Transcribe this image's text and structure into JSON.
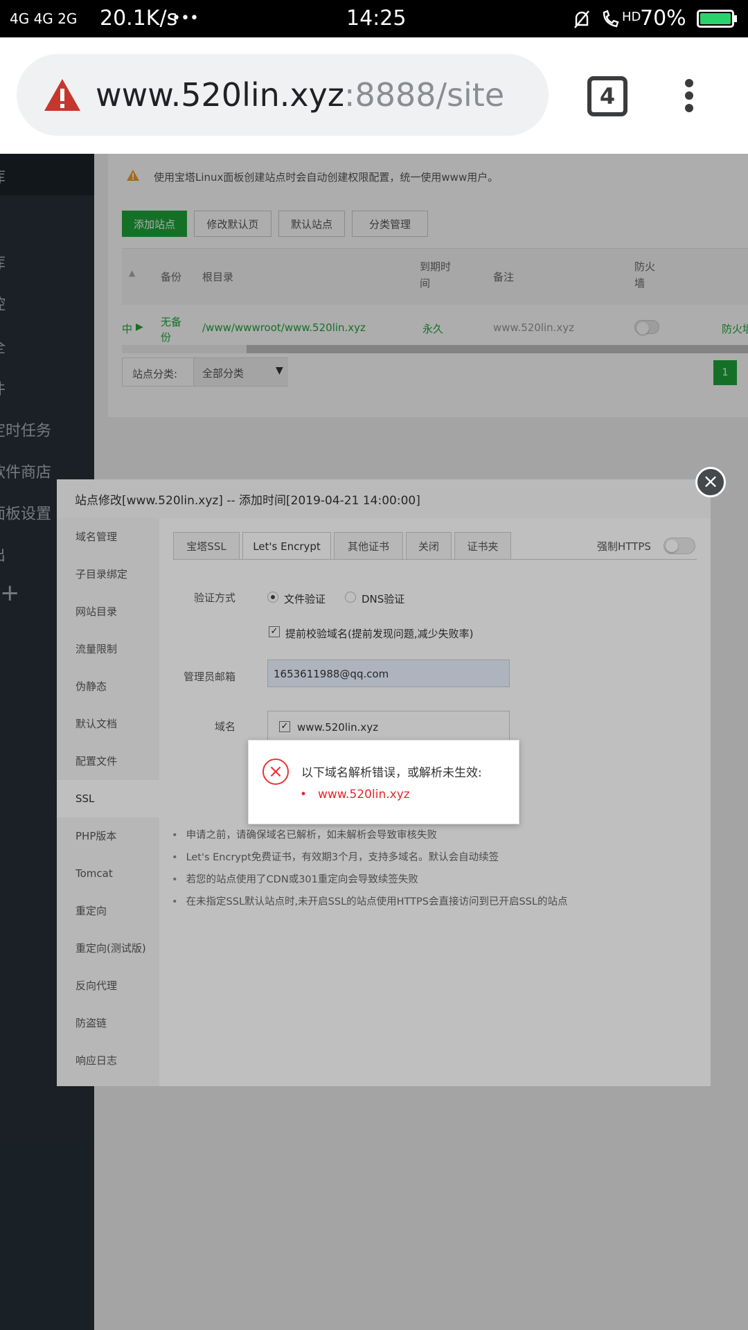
{
  "status_bar": {
    "network": "4G 4G 2G",
    "speed": "20.1K/s",
    "dots": "•••",
    "time": "14:25",
    "hd": "HD",
    "battery": "70%"
  },
  "browser": {
    "url_host": "www.520lin.xyz",
    "url_path": ":8888/site",
    "tab_count": "4",
    "security_icon": "warning-triangle-icon",
    "menu_icon": "vertical-dots-icon"
  },
  "sidebar": {
    "items": [
      "库",
      "库",
      "控",
      "全",
      "件",
      "定时任务",
      "软件商店",
      "面板设置",
      "出"
    ]
  },
  "site_page": {
    "notice": "使用宝塔Linux面板创建站点时会自动创建权限配置，统一使用www用户。",
    "buttons": [
      "添加站点",
      "修改默认页",
      "默认站点",
      "分类管理"
    ],
    "columns": [
      "备份",
      "根目录",
      "到期时间",
      "备注",
      "防火墙"
    ],
    "row": {
      "status": "中",
      "backup": "无备份",
      "root": "/www/wwwroot/www.520lin.xyz",
      "expire": "永久",
      "remark": "www.520lin.xyz",
      "action": "防火墙 |"
    },
    "category_label": "站点分类:",
    "category_value": "全部分类",
    "page_number": "1"
  },
  "modal": {
    "title": "站点修改[www.520lin.xyz] -- 添加时间[2019-04-21 14:00:00]",
    "menu": [
      "域名管理",
      "子目录绑定",
      "网站目录",
      "流量限制",
      "伪静态",
      "默认文档",
      "配置文件",
      "SSL",
      "PHP版本",
      "Tomcat",
      "重定向",
      "重定向(测试版)",
      "反向代理",
      "防盗链",
      "响应日志"
    ],
    "active_menu": "SSL",
    "tabs": [
      "宝塔SSL",
      "Let's Encrypt",
      "其他证书",
      "关闭",
      "证书夹"
    ],
    "force_https": "强制HTTPS",
    "verify_label": "验证方式",
    "verify_file": "文件验证",
    "verify_dns": "DNS验证",
    "precheck": "提前校验域名(提前发现问题,减少失败率)",
    "email_label": "管理员邮箱",
    "email_value": "1653611988@qq.com",
    "domain_label": "域名",
    "domain_value": "www.520lin.xyz",
    "notes": [
      "申请之前，请确保域名已解析，如未解析会导致审核失败",
      "Let's Encrypt免费证书，有效期3个月，支持多域名。默认会自动续签",
      "若您的站点使用了CDN或301重定向会导致续签失败",
      "在未指定SSL默认站点时,未开启SSL的站点使用HTTPS会直接访问到已开启SSL的站点"
    ]
  },
  "error_box": {
    "message": "以下域名解析错误，或解析未生效:",
    "domain": "www.520lin.xyz",
    "icon": "error-x-icon"
  }
}
